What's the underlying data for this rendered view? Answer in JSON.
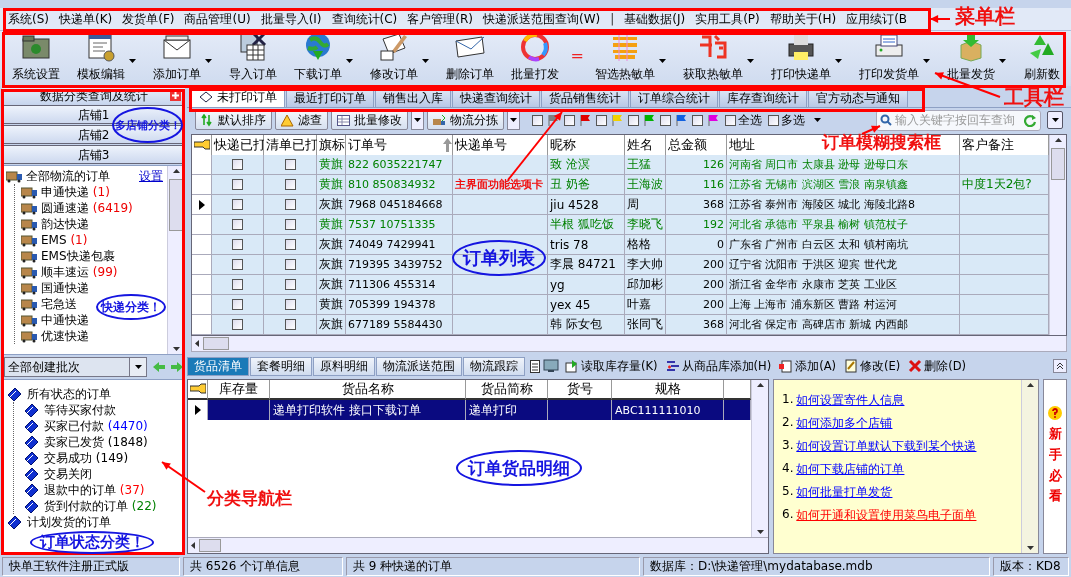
{
  "menu_bar": {
    "framed": true,
    "items": [
      "系统(S)",
      "快递单(K)",
      "发货单(F)",
      "商品管理(U)",
      "批量导入(I)",
      "查询统计(C)",
      "客户管理(R)",
      "快递派送范围查询(W)",
      "|",
      "基础数据(J)",
      "实用工具(P)",
      "帮助关于(H)",
      "应用续订(B"
    ]
  },
  "toolbar": {
    "framed": true,
    "items": [
      {
        "kind": "button",
        "label": "系统设置",
        "dropdown": false
      },
      {
        "kind": "button",
        "label": "模板编辑",
        "dropdown": true
      },
      {
        "kind": "button",
        "label": "添加订单",
        "dropdown": true
      },
      {
        "kind": "button",
        "label": "导入订单",
        "dropdown": false
      },
      {
        "kind": "button",
        "label": "下载订单",
        "dropdown": true
      },
      {
        "kind": "button",
        "label": "修改订单",
        "dropdown": true
      },
      {
        "kind": "button",
        "label": "删除订单",
        "dropdown": false
      },
      {
        "kind": "button",
        "label": "批量打发",
        "dropdown": false
      },
      {
        "kind": "symbol",
        "label": "="
      },
      {
        "kind": "button",
        "label": "智选热敏单",
        "dropdown": true
      },
      {
        "kind": "button",
        "label": "获取热敏单",
        "dropdown": true
      },
      {
        "kind": "button",
        "label": "打印快递单",
        "dropdown": true
      },
      {
        "kind": "button",
        "label": "打印发货单",
        "dropdown": true
      },
      {
        "kind": "button",
        "label": "批量发货",
        "dropdown": true
      },
      {
        "kind": "button",
        "label": "刷新数",
        "dropdown": false
      }
    ]
  },
  "sidebar": {
    "framed": true,
    "title": "数据分类查询及统计",
    "shops": [
      "店铺1",
      "店铺2",
      "店铺3"
    ],
    "courier_tree": {
      "label": "全部物流的订单",
      "link": "设置",
      "children": [
        {
          "label": "申通快递",
          "count": "(1)"
        },
        {
          "label": "圆通速递",
          "count": "(6419)"
        },
        {
          "label": "韵达快递"
        },
        {
          "label": "EMS",
          "count": "(1)"
        },
        {
          "label": "EMS快递包裹"
        },
        {
          "label": "顺丰速运",
          "count": "(99)"
        },
        {
          "label": "国通快递"
        },
        {
          "label": "宅急送"
        },
        {
          "label": "中通快递"
        },
        {
          "label": "优速快递"
        }
      ]
    },
    "batch_select": {
      "value": "全部创建批次"
    },
    "status_tree": [
      {
        "label": "所有状态的订单",
        "children": [
          {
            "label": "等待买家付款"
          },
          {
            "label": "买家已付款",
            "count": "(4470)",
            "color": "#0000ff"
          },
          {
            "label": "卖家已发货",
            "count": "(1848)",
            "color": "#000000"
          },
          {
            "label": "交易成功",
            "count": "(149)",
            "color": "#000000"
          },
          {
            "label": "交易关闭"
          },
          {
            "label": "退款中的订单",
            "count": "(37)",
            "color": "#ff0000"
          },
          {
            "label": "货到付款的订单",
            "count": "(22)",
            "color": "#008000"
          }
        ]
      },
      {
        "label": "计划发货的订单"
      }
    ]
  },
  "main_tabs": {
    "framed": true,
    "tabs": [
      {
        "label": "未打印订单",
        "selected": true
      },
      {
        "label": "最近打印订单",
        "selected": false
      },
      {
        "label": "销售出入库",
        "selected": false
      },
      {
        "label": "快递查询统计",
        "selected": false
      },
      {
        "label": "货品销售统计",
        "selected": false
      },
      {
        "label": "订单综合统计",
        "selected": false
      },
      {
        "label": "库存查询统计",
        "selected": false
      },
      {
        "label": "官方动态与通知",
        "selected": false
      }
    ]
  },
  "order_toolbar": {
    "buttons": [
      {
        "label": "默认排序",
        "dropdown": false
      },
      {
        "label": "滤查",
        "dropdown": false
      },
      {
        "label": "批量修改",
        "dropdown": true
      },
      {
        "label": "物流分拣",
        "dropdown": true
      }
    ],
    "flags": [
      {
        "color": "#808080",
        "checked": false
      },
      {
        "color": "#e00000",
        "checked": false
      },
      {
        "color": "#f0d000",
        "checked": false
      },
      {
        "color": "#00b000",
        "checked": false
      },
      {
        "color": "#1060e0",
        "checked": false
      },
      {
        "color": "#e000e0",
        "checked": false
      }
    ],
    "options": [
      {
        "label": "全选",
        "checked": false
      },
      {
        "label": "多选",
        "checked": false
      }
    ],
    "search": {
      "placeholder": "输入关键字按回车查询"
    }
  },
  "order_table": {
    "columns": [
      "快递已打",
      "清单已打",
      "旗标",
      "订单号",
      "快递单号",
      "昵称",
      "姓名",
      "总金额",
      "地址",
      "客户备注"
    ],
    "rows": [
      {
        "selected": false,
        "highlighted": true,
        "express_printed": false,
        "list_printed": false,
        "flag": "黄旗",
        "order_no": "822 6035221747",
        "nickname": "致 沧溟",
        "name": "王猛",
        "total": "126",
        "address": "河南省 周口市 太康县 逊母 逊母口东"
      },
      {
        "selected": false,
        "highlighted": true,
        "express_printed": false,
        "list_printed": false,
        "flag": "黄旗",
        "order_no": "810 850834932",
        "nickname": "丑 奶爸",
        "name": "王海波",
        "total": "116",
        "address": "江苏省 无锡市 滨湖区 雪浪 南泉镇鑫",
        "note": "中度1天2包?"
      },
      {
        "selected": true,
        "highlighted": false,
        "express_printed": false,
        "list_printed": false,
        "flag": "灰旗",
        "order_no": "7968 045184668",
        "nickname": "jiu 4528",
        "name": "周",
        "total": "368",
        "address": "江苏省 泰州市 海陵区 城北 海陵北路8"
      },
      {
        "selected": false,
        "highlighted": true,
        "express_printed": false,
        "list_printed": false,
        "flag": "黄旗",
        "order_no": "7537 10751335",
        "nickname": "半根 狐吃饭",
        "name": "李晓飞",
        "total": "192",
        "address": "河北省 承德市 平泉县 榆树 镇范杖子"
      },
      {
        "selected": false,
        "highlighted": false,
        "express_printed": false,
        "list_printed": false,
        "flag": "灰旗",
        "order_no": "74049 7429941",
        "nickname": "tris 78",
        "name": "格格",
        "total": "0",
        "address": "广东省 广州市 白云区 太和 镇村南坑"
      },
      {
        "selected": false,
        "highlighted": false,
        "express_printed": false,
        "list_printed": false,
        "flag": "灰旗",
        "order_no": "719395 3439752",
        "nickname": "李晨 84721",
        "name": "李大帅",
        "total": "200",
        "address": "辽宁省 沈阳市 于洪区 迎宾 世代龙"
      },
      {
        "selected": false,
        "highlighted": false,
        "express_printed": false,
        "list_printed": false,
        "flag": "灰旗",
        "order_no": "711306 455314",
        "nickname": "yg",
        "name": "邱加彬",
        "total": "200",
        "address": "浙江省 金华市 永康市 芝英 工业区"
      },
      {
        "selected": false,
        "highlighted": false,
        "express_printed": false,
        "list_printed": false,
        "flag": "黄旗",
        "order_no": "705399 194378",
        "nickname": "yex 45",
        "name": "叶嘉",
        "total": "200",
        "address": "上海 上海市 浦东新区 曹路 村运河"
      },
      {
        "selected": false,
        "highlighted": false,
        "express_printed": false,
        "list_printed": false,
        "flag": "灰旗",
        "order_no": "677189 5584430",
        "nickname": "韩 际女包",
        "name": "张同飞",
        "total": "368",
        "address": "河北省 保定市 高碑店市 新城 内西邮"
      }
    ]
  },
  "detail_tabs": [
    {
      "label": "货品清单",
      "selected": true
    },
    {
      "label": "套餐明细",
      "selected": false
    },
    {
      "label": "原料明细",
      "selected": false
    },
    {
      "label": "物流派送范围",
      "selected": false
    },
    {
      "label": "物流跟踪",
      "selected": false
    }
  ],
  "detail_toolbar": [
    "读取库存量(K)",
    "从商品库添加(H)",
    "添加(A)",
    "修改(E)",
    "删除(D)"
  ],
  "detail_table": {
    "columns": [
      "库存量",
      "货品名称",
      "货品简称",
      "货号",
      "规格"
    ],
    "rows": [
      {
        "selected": true,
        "name": "递单打印软件 接口下载订单",
        "short_name": "递单打印",
        "spec": "ABC111111010"
      }
    ]
  },
  "help": {
    "title": "新手必看",
    "links": [
      {
        "number": "1.",
        "text": "如何设置寄件人信息",
        "color": "#0000ff"
      },
      {
        "number": "2.",
        "text": "如何添加多个店铺",
        "color": "#0000ff"
      },
      {
        "number": "3.",
        "text": "如何设置订单默认下载到某个快递",
        "color": "#0000ff"
      },
      {
        "number": "4.",
        "text": "如何下载店铺的订单",
        "color": "#0000ff"
      },
      {
        "number": "5.",
        "text": "如何批量打单发货",
        "color": "#0000ff"
      },
      {
        "number": "6.",
        "text": "如何开通和设置使用菜鸟电子面单",
        "color": "#ff0000"
      }
    ]
  },
  "status_bar": [
    "快单王软件注册正式版",
    "共 6526 个订单信息",
    "共 9 种快递的订单",
    "数据库：D:\\快递管理\\mydatabase.mdb",
    "版本：KD8"
  ],
  "annotations": [
    {
      "kind": "callout",
      "text": "菜单栏"
    },
    {
      "kind": "callout",
      "text": "工具栏"
    },
    {
      "kind": "callout",
      "text": "主界面功能选项卡"
    },
    {
      "kind": "callout",
      "text": "订单模糊搜索框"
    },
    {
      "kind": "callout",
      "text": "分类导航栏"
    },
    {
      "kind": "ellipse",
      "text": "多店铺分类！"
    },
    {
      "kind": "ellipse",
      "text": "快递分类！"
    },
    {
      "kind": "ellipse",
      "text": "订单列表"
    },
    {
      "kind": "ellipse",
      "text": "订单状态分类！"
    },
    {
      "kind": "ellipse",
      "text": "订单货品明细"
    }
  ]
}
